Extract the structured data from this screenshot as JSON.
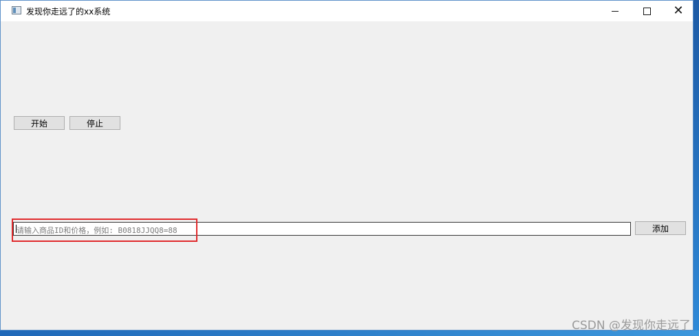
{
  "window": {
    "title": "发现你走远了的xx系统",
    "controls": {
      "minimize_icon": "minimize-icon",
      "maximize_icon": "maximize-icon",
      "close_icon": "close-icon",
      "close_glyph": "✕"
    }
  },
  "toolbar": {
    "start_label": "开始",
    "stop_label": "停止"
  },
  "input": {
    "placeholder": "请输入商品ID和价格，例如: B0818JJQQ8=88",
    "value": ""
  },
  "add_label": "添加",
  "watermark": "CSDN @发现你走远了",
  "colors": {
    "highlight": "#e0282a",
    "window_bg": "#f0f0f0",
    "desktop": "#2b6fb6"
  }
}
